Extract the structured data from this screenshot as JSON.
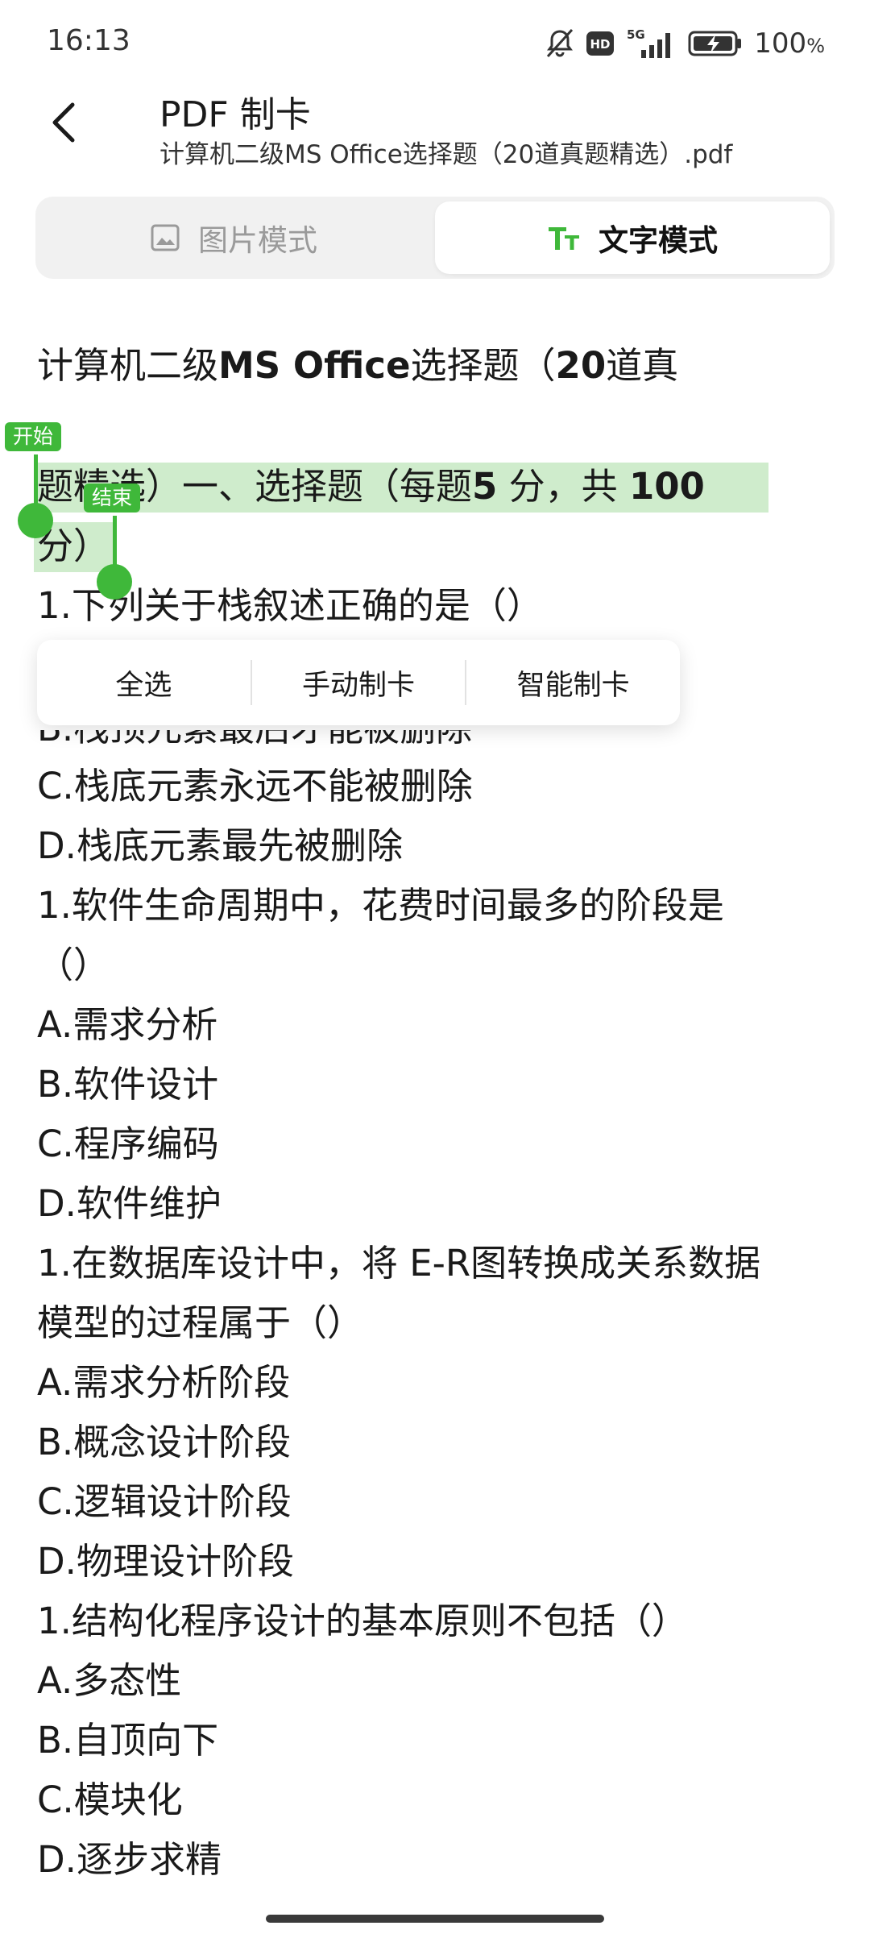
{
  "status_bar": {
    "time": "16:13",
    "network": "5G",
    "hd": "HD",
    "battery": "100",
    "battery_unit": "%"
  },
  "header": {
    "title": "PDF 制卡",
    "subtitle": "计算机二级MS Office选择题（20道真题精选）.pdf"
  },
  "mode_toggle": {
    "image_mode_label": "图片模式",
    "text_mode_label": "文字模式",
    "active": "text"
  },
  "selection": {
    "start_label": "开始",
    "end_label": "结束",
    "highlight_color": "#cfeccc",
    "handle_color": "#3fb83a"
  },
  "context_menu": {
    "select_all": "全选",
    "manual_card": "手动制卡",
    "smart_card": "智能制卡"
  },
  "document": {
    "title_line1_a": "计算机二级",
    "title_line1_b": "MS Office",
    "title_line1_c": "选择题（",
    "title_line1_d": "20",
    "title_line1_e": "道真",
    "line2_a": "题精选）一、选择题（每题",
    "line2_b": "5",
    "line2_c": " 分，共 ",
    "line2_d": "100",
    "line3": "分）",
    "q1": "1.下列关于栈叙述正确的是（）",
    "q1_b_partial": "B.栈顶元素最后才能被删除",
    "q1_c": "C.栈底元素永远不能被删除",
    "q1_d": "D.栈底元素最先被删除",
    "q2": "1.软件生命周期中，花费时间最多的阶段是",
    "q2_cont": "（）",
    "q2_a": "A.需求分析",
    "q2_b": "B.软件设计",
    "q2_c": "C.程序编码",
    "q2_d": "D.软件维护",
    "q3": "1.在数据库设计中，将 E-R图转换成关系数据",
    "q3_cont": "模型的过程属于（）",
    "q3_a": "A.需求分析阶段",
    "q3_b": "B.概念设计阶段",
    "q3_c": "C.逻辑设计阶段",
    "q3_d": "D.物理设计阶段",
    "q4": "1.结构化程序设计的基本原则不包括（）",
    "q4_a": "A.多态性",
    "q4_b": "B.自顶向下",
    "q4_c": "C.模块化",
    "q4_d": "D.逐步求精"
  }
}
